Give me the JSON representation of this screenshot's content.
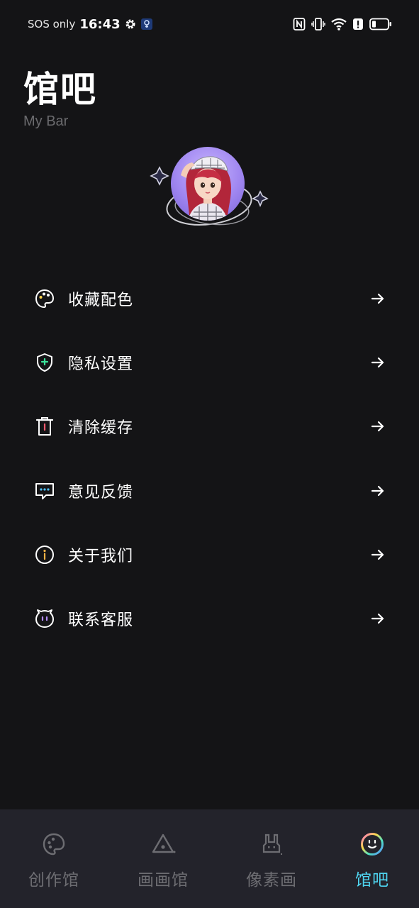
{
  "status_bar": {
    "carrier": "SOS only",
    "time": "16:43"
  },
  "header": {
    "title": "馆吧",
    "subtitle": "My Bar"
  },
  "menu": {
    "items": [
      {
        "label": "收藏配色",
        "icon": "palette-icon"
      },
      {
        "label": "隐私设置",
        "icon": "shield-plus-icon"
      },
      {
        "label": "清除缓存",
        "icon": "trash-icon"
      },
      {
        "label": "意见反馈",
        "icon": "chat-bubble-icon"
      },
      {
        "label": "关于我们",
        "icon": "info-icon"
      },
      {
        "label": "联系客服",
        "icon": "customer-service-icon"
      }
    ]
  },
  "bottom_nav": {
    "active_index": 3,
    "items": [
      {
        "label": "创作馆",
        "icon": "palette-icon"
      },
      {
        "label": "画画馆",
        "icon": "triangle-eye-icon"
      },
      {
        "label": "像素画",
        "icon": "pixel-bunny-icon"
      },
      {
        "label": "馆吧",
        "icon": "smiley-icon"
      }
    ]
  },
  "colors": {
    "background": "#141416",
    "nav_background": "#23232b",
    "active_tab": "#4fd6f2",
    "inactive_tab": "#6d6d72",
    "subtitle": "#6b6b6e"
  }
}
